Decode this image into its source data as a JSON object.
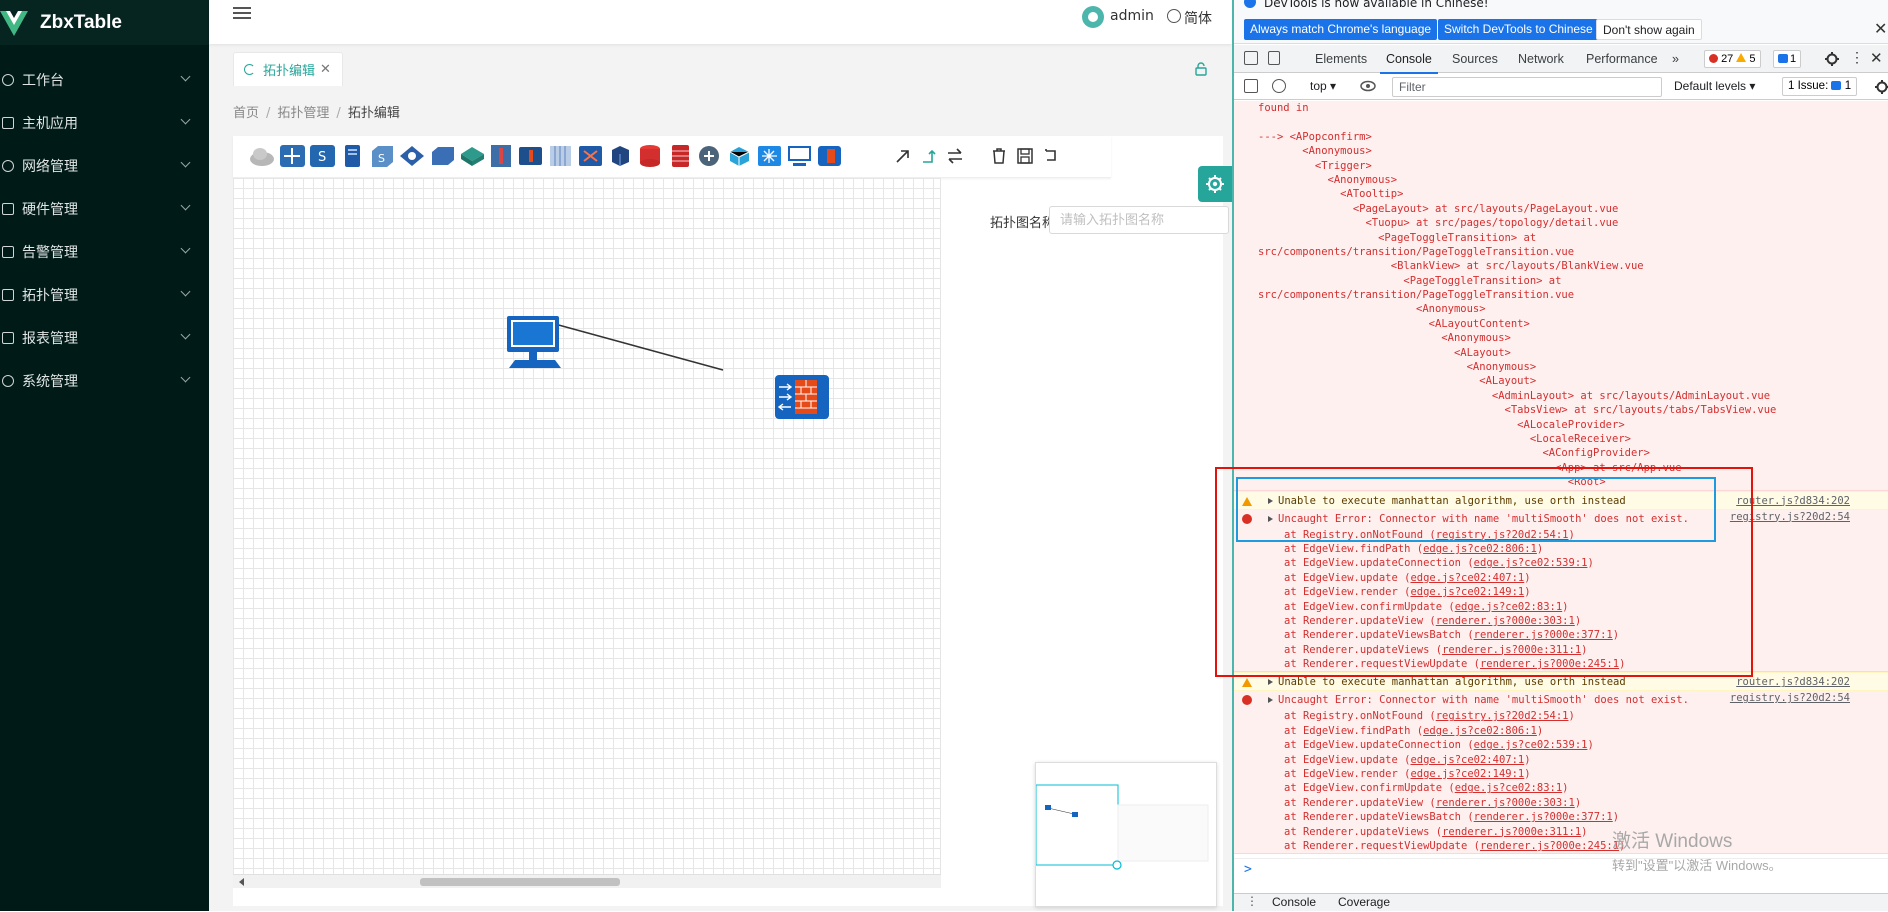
{
  "sidebar": {
    "brand": "ZbxTable",
    "items": [
      {
        "label": "工作台",
        "icon": "dashboard-icon"
      },
      {
        "label": "主机应用",
        "icon": "host-icon"
      },
      {
        "label": "网络管理",
        "icon": "network-icon"
      },
      {
        "label": "硬件管理",
        "icon": "hardware-icon"
      },
      {
        "label": "告警管理",
        "icon": "alarm-icon"
      },
      {
        "label": "拓扑管理",
        "icon": "topology-icon"
      },
      {
        "label": "报表管理",
        "icon": "report-icon"
      },
      {
        "label": "系统管理",
        "icon": "settings-icon"
      }
    ]
  },
  "header": {
    "user": "admin",
    "language": "简体"
  },
  "tab": {
    "label": "拓扑编辑"
  },
  "breadcrumb": [
    "首页",
    "拓扑管理",
    "拓扑编辑"
  ],
  "form": {
    "name_label": "拓扑图名称:",
    "name_placeholder": "请输入拓扑图名称"
  },
  "colors": {
    "accent": "#26a69a",
    "sidebar_bg": "#001a17",
    "error": "#d32f2f",
    "highlight_red": "#e3120b",
    "highlight_blue": "#1e9be0"
  },
  "devtools": {
    "info_text": "DevTools is now available in Chinese!",
    "btn_match": "Always match Chrome's language",
    "btn_switch": "Switch DevTools to Chinese",
    "btn_dont_show": "Don't show again",
    "tabs": [
      "Elements",
      "Console",
      "Sources",
      "Network",
      "Performance"
    ],
    "more_tabs": "»",
    "error_count": "27",
    "warning_count": "5",
    "message_count": "1",
    "context": "top",
    "filter_placeholder": "Filter",
    "levels": "Default levels",
    "issues_label": "1 Issue:",
    "issues_count": "1",
    "drawer_tabs": [
      "Console",
      "Coverage"
    ],
    "trace_lines": [
      "found in",
      "",
      "---> <APopconfirm>",
      "       <Anonymous>",
      "         <Trigger>",
      "           <Anonymous>",
      "             <ATooltip>",
      "               <PageLayout> at src/layouts/PageLayout.vue",
      "                 <Tuopu> at src/pages/topology/detail.vue",
      "                   <PageToggleTransition> at",
      "src/components/transition/PageToggleTransition.vue",
      "                     <BlankView> at src/layouts/BlankView.vue",
      "                       <PageToggleTransition> at",
      "src/components/transition/PageToggleTransition.vue",
      "                         <Anonymous>",
      "                           <ALayoutContent>",
      "                             <Anonymous>",
      "                               <ALayout>",
      "                                 <Anonymous>",
      "                                   <ALayout>",
      "                                     <AdminLayout> at src/layouts/AdminLayout.vue",
      "                                       <TabsView> at src/layouts/tabs/TabsView.vue",
      "                                         <ALocaleProvider>",
      "                                           <LocaleReceiver>",
      "                                             <AConfigProvider>",
      "                                               <App> at src/App.vue",
      "                                                 <Root>"
    ],
    "warning_msg": "Unable to execute manhattan algorithm, use orth instead",
    "warning_src": "router.js?d834:202",
    "error_msg": "Uncaught Error: Connector with name 'multiSmooth' does not exist.",
    "error_src": "registry.js?20d2:54",
    "stack": [
      {
        "fn": "at Registry.onNotFound",
        "loc": "registry.js?20d2:54:1"
      },
      {
        "fn": "at EdgeView.findPath",
        "loc": "edge.js?ce02:806:1"
      },
      {
        "fn": "at EdgeView.updateConnection",
        "loc": "edge.js?ce02:539:1"
      },
      {
        "fn": "at EdgeView.update",
        "loc": "edge.js?ce02:407:1"
      },
      {
        "fn": "at EdgeView.render",
        "loc": "edge.js?ce02:149:1"
      },
      {
        "fn": "at EdgeView.confirmUpdate",
        "loc": "edge.js?ce02:83:1"
      },
      {
        "fn": "at Renderer.updateView",
        "loc": "renderer.js?000e:303:1"
      },
      {
        "fn": "at Renderer.updateViewsBatch",
        "loc": "renderer.js?000e:377:1"
      },
      {
        "fn": "at Renderer.updateViews",
        "loc": "renderer.js?000e:311:1"
      },
      {
        "fn": "at Renderer.requestViewUpdate",
        "loc": "renderer.js?000e:245:1"
      }
    ]
  },
  "watermark": {
    "line1": "激活 Windows",
    "line2": "转到\"设置\"以激活 Windows。"
  }
}
